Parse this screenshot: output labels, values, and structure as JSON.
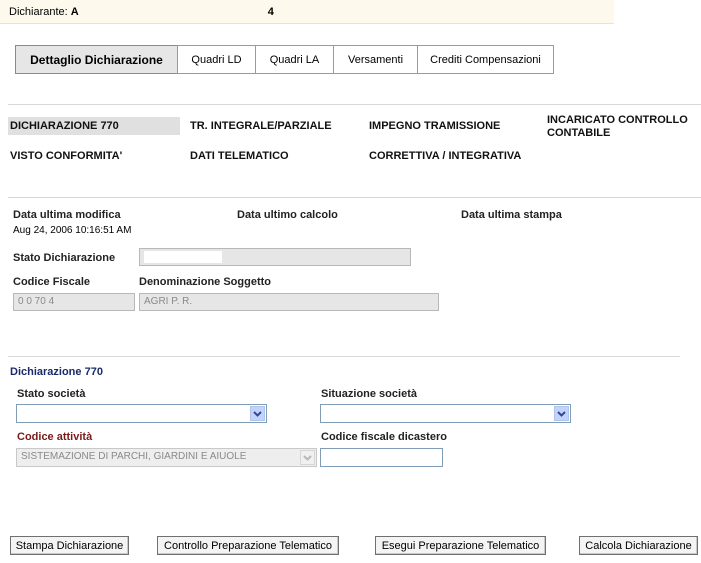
{
  "header": {
    "dichiarante_label": "Dichiarante:",
    "dichiarante_name": "A",
    "dichiarante_suffix": "4"
  },
  "tabs": [
    {
      "label": "Dettaglio Dichiarazione",
      "active": true
    },
    {
      "label": "Quadri LD"
    },
    {
      "label": "Quadri LA"
    },
    {
      "label": "Versamenti"
    },
    {
      "label": "Crediti Compensazioni"
    }
  ],
  "flags": {
    "dichiarazione_770": "DICHIARAZIONE 770",
    "tr_integrale": "TR. INTEGRALE/PARZIALE",
    "impegno": "IMPEGNO TRAMISSIONE",
    "incaricato": "INCARICATO CONTROLLO CONTABILE",
    "visto": "VISTO CONFORMITA'",
    "dati_telematico": "DATI TELEMATICO",
    "correttiva": "CORRETTIVA / INTEGRATIVA"
  },
  "dates": {
    "ultima_modifica_label": "Data ultima modifica",
    "ultima_modifica_value": "Aug 24, 2006 10:16:51 AM",
    "ultimo_calcolo_label": "Data ultimo calcolo",
    "ultima_stampa_label": "Data ultima stampa"
  },
  "stato": {
    "label": "Stato Dichiarazione"
  },
  "soggetto": {
    "codice_fiscale_label": "Codice Fiscale",
    "codice_fiscale_value": "0  0  70  4",
    "denominazione_label": "Denominazione Soggetto",
    "denominazione_value": "AGRI    P.   R."
  },
  "dich770": {
    "section_title": "Dichiarazione 770",
    "stato_societa_label": "Stato società",
    "situazione_societa_label": "Situazione società",
    "codice_attivita_label": "Codice attività",
    "codice_attivita_value": "SISTEMAZIONE DI PARCHI, GIARDINI E AIUOLE",
    "codice_fiscale_dicastero_label": "Codice fiscale dicastero"
  },
  "buttons": {
    "stampa": "Stampa Dichiarazione",
    "controllo": "Controllo Preparazione Telematico",
    "esegui": "Esegui Preparazione Telematico",
    "calcola": "Calcola Dichiarazione"
  }
}
